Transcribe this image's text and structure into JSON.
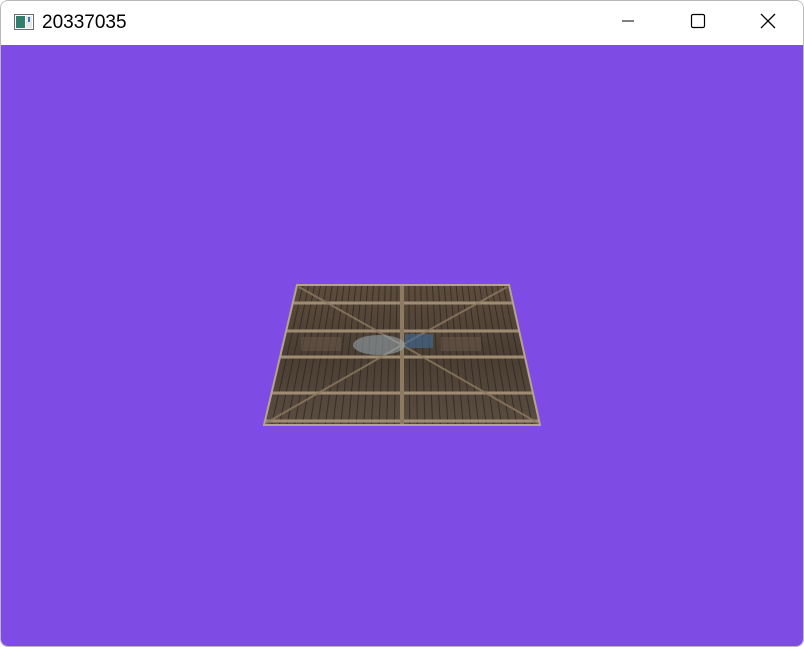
{
  "window": {
    "title": "20337035",
    "minimize_icon": "minimize-icon",
    "maximize_icon": "maximize-icon",
    "close_icon": "close-icon",
    "app_icon": "app-window-icon"
  },
  "scene": {
    "background_color": "#7f4be5",
    "object": "textured-wooden-plane",
    "wood_dark": "#3a3026",
    "wood_mid": "#5a4a3a",
    "wood_light": "#9c8a74",
    "frame_color": "#8d7a62"
  }
}
